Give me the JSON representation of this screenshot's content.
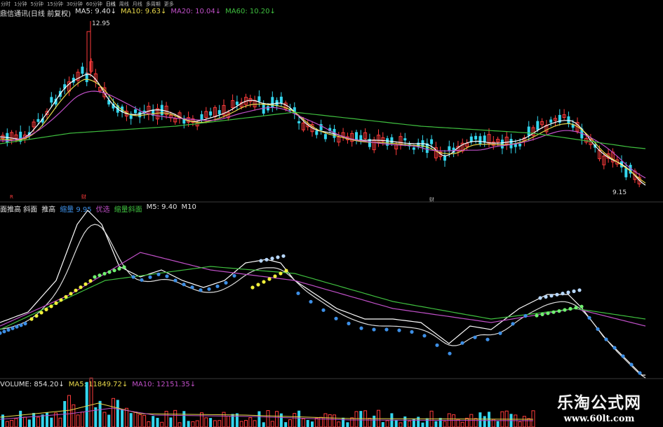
{
  "periods": [
    "分时",
    "1分钟",
    "5分钟",
    "15分钟",
    "30分钟",
    "60分钟",
    "日线",
    "周线",
    "月线",
    "多周期",
    "更多"
  ],
  "price_legend": {
    "title": "鼎信通讯(日线 前复权)",
    "ma5": "MA5: 9.40↓",
    "ma10": "MA10: 9.63↓",
    "ma20": "MA20: 10.04↓",
    "ma60": "MA60: 10.20↓"
  },
  "price_high_label": "12.95",
  "price_low_label": "9.15",
  "marker_r": "R",
  "marker_cai": "财",
  "indicator_legend": {
    "name": "面推高 斜面",
    "a": "推高",
    "b": "缩量 9.95",
    "c": "优选",
    "d": "缩量斜面",
    "e": "M5: 9.40",
    "f": "M10"
  },
  "volume_legend": {
    "vol": "VOLUME: 854.20↓",
    "ma5": "MA5: 11849.72↓",
    "ma10": "MA10: 12151.35↓"
  },
  "watermark": {
    "logo": "乐淘公式网",
    "url": "www.60lt.com"
  },
  "colors": {
    "up": "#ff3b3b",
    "down": "#33d6ee",
    "ma5": "#ffffff",
    "ma10": "#e8d84a",
    "ma20": "#c050c8",
    "ma60": "#3fbf3f",
    "dot_blue": "#3d8fe6",
    "dot_yellow": "#f0ef3a",
    "dot_green": "#6ff06f",
    "dot_lightblue": "#b8d8ff"
  }
}
